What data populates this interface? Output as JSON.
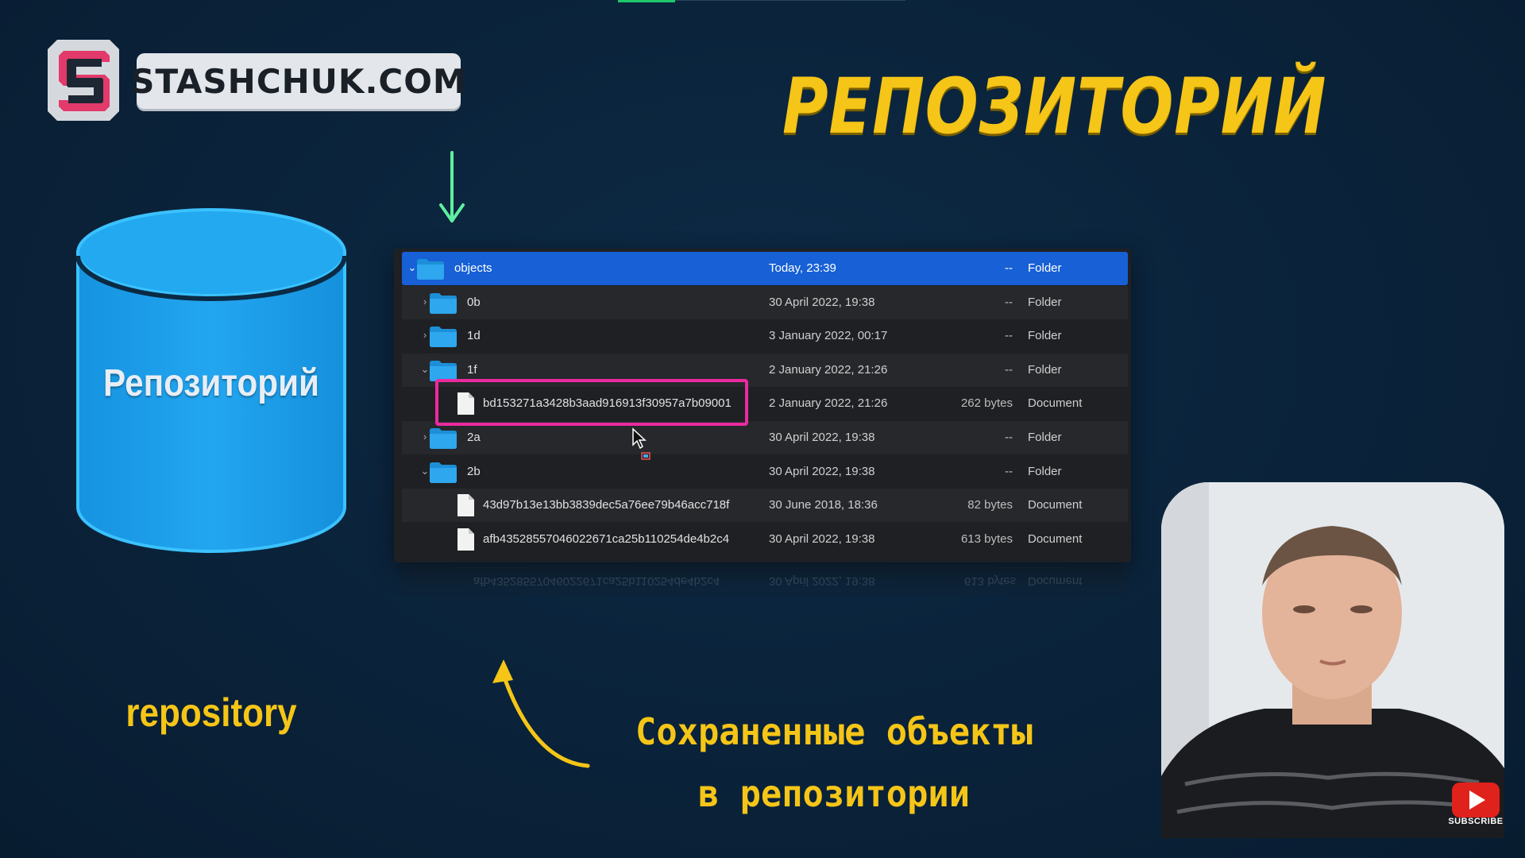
{
  "brand": {
    "logo_text": "STASHCHUK.COM",
    "logo_letter": "S"
  },
  "slide": {
    "title": "РЕПОЗИТОРИЙ",
    "cylinder_label": "Репозиторий",
    "repository_word": "repository",
    "caption_line1": "Сохраненные объекты",
    "caption_line2": "в репозитории"
  },
  "colors": {
    "accent_yellow": "#f5c517",
    "selection_blue": "#1760d6",
    "highlight_pink": "#ec2aa0",
    "cylinder_blue": "#1e9ee8",
    "arrow_green": "#5ef0a0"
  },
  "finder": {
    "rows": [
      {
        "name": "objects",
        "date": "Today, 23:39",
        "size": "--",
        "kind": "Folder",
        "icon": "folder-icon",
        "chevron": "expanded",
        "selected": true
      },
      {
        "name": "0b",
        "date": "30 April 2022, 19:38",
        "size": "--",
        "kind": "Folder",
        "icon": "folder-icon",
        "chevron": "collapsed"
      },
      {
        "name": "1d",
        "date": "3 January 2022, 00:17",
        "size": "--",
        "kind": "Folder",
        "icon": "folder-icon",
        "chevron": "collapsed"
      },
      {
        "name": "1f",
        "date": "2 January 2022, 21:26",
        "size": "--",
        "kind": "Folder",
        "icon": "folder-icon",
        "chevron": "expanded"
      },
      {
        "name": "bd153271a3428b3aad916913f30957a7b09001",
        "date": "2 January 2022, 21:26",
        "size": "262 bytes",
        "kind": "Document",
        "icon": "document-icon",
        "chevron": "none"
      },
      {
        "name": "2a",
        "date": "30 April 2022, 19:38",
        "size": "--",
        "kind": "Folder",
        "icon": "folder-icon",
        "chevron": "collapsed"
      },
      {
        "name": "2b",
        "date": "30 April 2022, 19:38",
        "size": "--",
        "kind": "Folder",
        "icon": "folder-icon",
        "chevron": "expanded"
      },
      {
        "name": "43d97b13e13bb3839dec5a76ee79b46acc718f",
        "date": "30 June 2018, 18:36",
        "size": "82 bytes",
        "kind": "Document",
        "icon": "document-icon",
        "chevron": "none"
      },
      {
        "name": "afb43528557046022671ca25b110254de4b2c4",
        "date": "30 April 2022, 19:38",
        "size": "613 bytes",
        "kind": "Document",
        "icon": "document-icon",
        "chevron": "none"
      }
    ]
  },
  "overlay": {
    "subscribe_label": "SUBSCRIBE"
  }
}
